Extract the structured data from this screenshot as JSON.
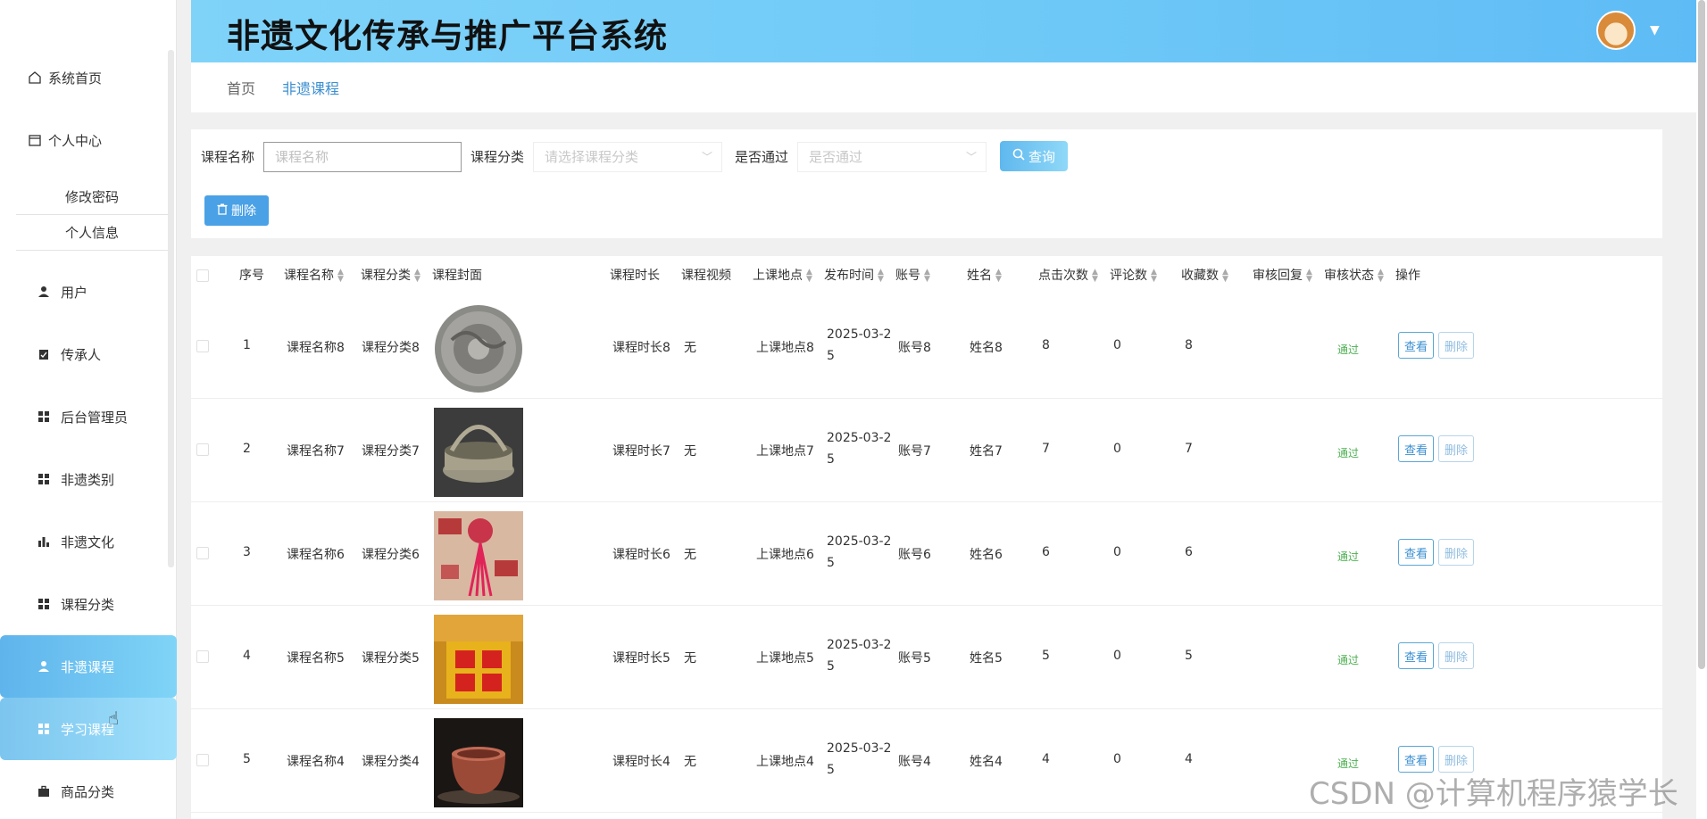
{
  "header": {
    "title": "非遗文化传承与推广平台系统",
    "avatar_icon": "avatar-icon",
    "caret": "▼"
  },
  "sidebar": {
    "items": [
      {
        "label": "系统首页",
        "icon": "home-icon"
      },
      {
        "label": "个人中心",
        "icon": "folder-icon"
      },
      {
        "label": "修改密码"
      },
      {
        "label": "个人信息"
      },
      {
        "label": "用户",
        "icon": "user-icon"
      },
      {
        "label": "传承人",
        "icon": "clipboard-icon"
      },
      {
        "label": "后台管理员",
        "icon": "grid-icon"
      },
      {
        "label": "非遗类别",
        "icon": "grid-icon"
      },
      {
        "label": "非遗文化",
        "icon": "bar-chart-icon"
      },
      {
        "label": "课程分类",
        "icon": "grid-icon"
      },
      {
        "label": "非遗课程",
        "icon": "user-icon"
      },
      {
        "label": "学习课程",
        "icon": "grid-icon"
      },
      {
        "label": "商品分类",
        "icon": "briefcase-icon"
      }
    ]
  },
  "breadcrumb": {
    "home": "首页",
    "current": "非遗课程"
  },
  "filter": {
    "name_label": "课程名称",
    "name_placeholder": "课程名称",
    "category_label": "课程分类",
    "category_placeholder": "请选择课程分类",
    "pass_label": "是否通过",
    "pass_placeholder": "是否通过",
    "search_label": "查询",
    "delete_label": "删除"
  },
  "table": {
    "headers": [
      "序号",
      "课程名称",
      "课程分类",
      "课程封面",
      "课程时长",
      "课程视频",
      "上课地点",
      "发布时间",
      "账号",
      "姓名",
      "点击次数",
      "评论数",
      "收藏数",
      "审核回复",
      "审核状态",
      "操作"
    ],
    "view_label": "查看",
    "delete_label": "删除",
    "rows": [
      {
        "no": "1",
        "name": "课程名称8",
        "category": "课程分类8",
        "duration": "课程时长8",
        "video": "无",
        "location": "上课地点8",
        "date_a": "2025-03-2",
        "date_b": "5",
        "account": "账号8",
        "person": "姓名8",
        "clicks": "8",
        "comments": "0",
        "favorites": "8",
        "status": "通过"
      },
      {
        "no": "2",
        "name": "课程名称7",
        "category": "课程分类7",
        "duration": "课程时长7",
        "video": "无",
        "location": "上课地点7",
        "date_a": "2025-03-2",
        "date_b": "5",
        "account": "账号7",
        "person": "姓名7",
        "clicks": "7",
        "comments": "0",
        "favorites": "7",
        "status": "通过"
      },
      {
        "no": "3",
        "name": "课程名称6",
        "category": "课程分类6",
        "duration": "课程时长6",
        "video": "无",
        "location": "上课地点6",
        "date_a": "2025-03-2",
        "date_b": "5",
        "account": "账号6",
        "person": "姓名6",
        "clicks": "6",
        "comments": "0",
        "favorites": "6",
        "status": "通过"
      },
      {
        "no": "4",
        "name": "课程名称5",
        "category": "课程分类5",
        "duration": "课程时长5",
        "video": "无",
        "location": "上课地点5",
        "date_a": "2025-03-2",
        "date_b": "5",
        "account": "账号5",
        "person": "姓名5",
        "clicks": "5",
        "comments": "0",
        "favorites": "5",
        "status": "通过"
      },
      {
        "no": "5",
        "name": "课程名称4",
        "category": "课程分类4",
        "duration": "课程时长4",
        "video": "无",
        "location": "上课地点4",
        "date_a": "2025-03-2",
        "date_b": "5",
        "account": "账号4",
        "person": "姓名4",
        "clicks": "4",
        "comments": "0",
        "favorites": "4",
        "status": "通过"
      }
    ]
  },
  "watermark": "CSDN @计算机程序猿学长",
  "colors": {
    "accent": "#5fb8ee",
    "status_green": "#4caf50",
    "link_blue": "#3b8fd1"
  }
}
